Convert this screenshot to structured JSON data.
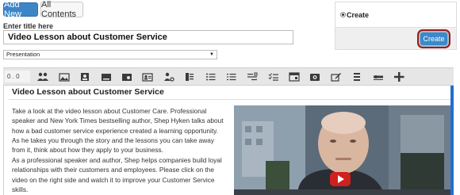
{
  "header": {
    "add_new_label": "Add New",
    "all_contents_label": "All Contents",
    "title_label": "Enter title here",
    "title_value": "Video Lesson about Customer Service",
    "content_type_selected": "Presentation"
  },
  "create_panel": {
    "radio_label": "Create",
    "create_button_label": "Create"
  },
  "toolbar": {
    "size_value": "0 . 0",
    "buttons": [
      "users-icon",
      "image-icon",
      "portrait-icon",
      "slide-icon",
      "picture-icon",
      "contact-card-icon",
      "person-settings-icon",
      "list-icon",
      "bullet-list-icon",
      "numbered-list-icon",
      "checklist-icon",
      "check-list-icon",
      "window-icon",
      "video-icon",
      "edit-icon",
      "columns-icon",
      "layout-icon",
      "plus-icon"
    ]
  },
  "editor": {
    "heading": "Video Lesson about Customer Service",
    "paragraph_1": "Take a look at the video lesson about Customer Care. Professional speaker and New York Times bestselling author, Shep Hyken talks about how a bad customer service experience created a learning opportunity. As he takes you through the story and the lessons you can take away from it, think about how they apply to your business.",
    "paragraph_2": "As a professional speaker and author, Shep helps companies build loyal relationships with their customers and employees. Please click on the video on the right side and watch it to improve your Customer Service skills."
  },
  "colors": {
    "primary_button": "#3c86c7",
    "highlight_ring": "#9d1a1a",
    "play_button": "#d0201d",
    "scrollbar": "#1f6fd0"
  }
}
